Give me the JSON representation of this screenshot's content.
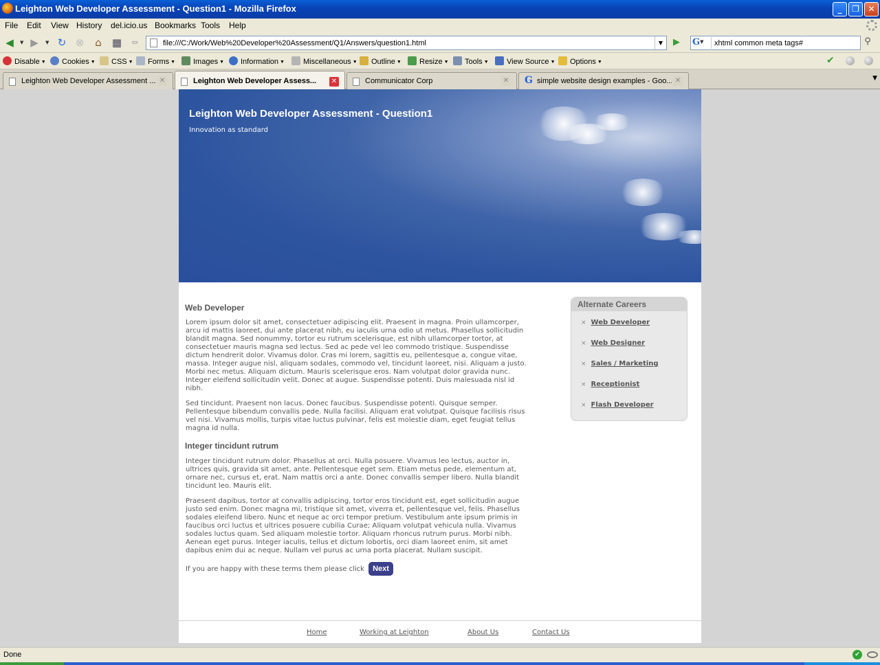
{
  "window": {
    "title": "Leighton Web Developer Assessment - Question1 - Mozilla Firefox",
    "minimize": "_",
    "maximize": "❐",
    "close": "✕"
  },
  "menubar": [
    "File",
    "Edit",
    "View",
    "History",
    "del.icio.us",
    "Bookmarks",
    "Tools",
    "Help"
  ],
  "navbar": {
    "url": "file:///C:/Work/Web%20Developer%20Assessment/Q1/Answers/question1.html",
    "search_engine": "G",
    "search_value": "xhtml common meta tags#"
  },
  "devtoolbar": [
    "Disable",
    "Cookies",
    "CSS",
    "Forms",
    "Images",
    "Information",
    "Miscellaneous",
    "Outline",
    "Resize",
    "Tools",
    "View Source",
    "Options"
  ],
  "tabs": [
    {
      "label": "Leighton Web Developer Assessment ..."
    },
    {
      "label": "Leighton Web Developer Assess..."
    },
    {
      "label": "Communicator Corp"
    },
    {
      "label": "simple website design examples - Goo..."
    }
  ],
  "page": {
    "site_title": "Leighton Web Developer Assessment - Question1",
    "tagline": "Innovation as standard",
    "heading1": "Web Developer",
    "para1": "Lorem ipsum dolor sit amet, consectetuer adipiscing elit. Praesent in magna. Proin ullamcorper, arcu id mattis laoreet, dui ante placerat nibh, eu iaculis urna odio ut metus. Phasellus sollicitudin blandit magna. Sed nonummy, tortor eu rutrum scelerisque, est nibh ullamcorper tortor, at consectetuer mauris magna sed lectus. Sed ac pede vel leo commodo tristique. Suspendisse dictum hendrerit dolor. Vivamus dolor. Cras mi lorem, sagittis eu, pellentesque a, congue vitae, massa. Integer augue nisl, aliquam sodales, commodo vel, tincidunt laoreet, nisi. Aliquam a justo. Morbi nec metus. Aliquam dictum. Mauris scelerisque eros. Nam volutpat dolor gravida nunc. Integer eleifend sollicitudin velit. Donec at augue. Suspendisse potenti. Duis malesuada nisl id nibh.",
    "para2": "Sed tincidunt. Praesent non lacus. Donec faucibus. Suspendisse potenti. Quisque semper. Pellentesque bibendum convallis pede. Nulla facilisi. Aliquam erat volutpat. Quisque facilisis risus vel nisi. Vivamus mollis, turpis vitae luctus pulvinar, felis est molestie diam, eget feugiat tellus magna id nulla.",
    "heading2": "Integer tincidunt rutrum",
    "para3": "Integer tincidunt rutrum dolor. Phasellus at orci. Nulla posuere. Vivamus leo lectus, auctor in, ultrices quis, gravida sit amet, ante. Pellentesque eget sem. Etiam metus pede, elementum at, ornare nec, cursus et, erat. Nam mattis orci a ante. Donec convallis semper libero. Nulla blandit tincidunt leo. Mauris elit.",
    "para4": "Praesent dapibus, tortor at convallis adipiscing, tortor eros tincidunt est, eget sollicitudin augue justo sed enim. Donec magna mi, tristique sit amet, viverra et, pellentesque vel, felis. Phasellus sodales eleifend libero. Nunc et neque ac orci tempor pretium. Vestibulum ante ipsum primis in faucibus orci luctus et ultrices posuere cubilia Curae; Aliquam volutpat vehicula nulla. Vivamus sodales luctus quam. Sed aliquam molestie tortor. Aliquam rhoncus rutrum purus. Morbi nibh. Aenean eget purus. Integer iaculis, tellus et dictum lobortis, orci diam laoreet enim, sit amet dapibus enim dui ac neque. Nullam vel purus ac urna porta placerat. Nullam suscipit.",
    "cta_text": "If you are happy with these terms them please click",
    "next_label": "Next",
    "sidebar": {
      "title": "Alternate Careers",
      "bullet": "×",
      "items": [
        "Web Developer",
        "Web Designer",
        "Sales / Marketing",
        "Receptionist",
        "Flash Developer"
      ]
    },
    "footer": [
      "Home",
      "Working at Leighton",
      "About Us",
      "Contact Us"
    ]
  },
  "statusbar": {
    "text": "Done"
  }
}
